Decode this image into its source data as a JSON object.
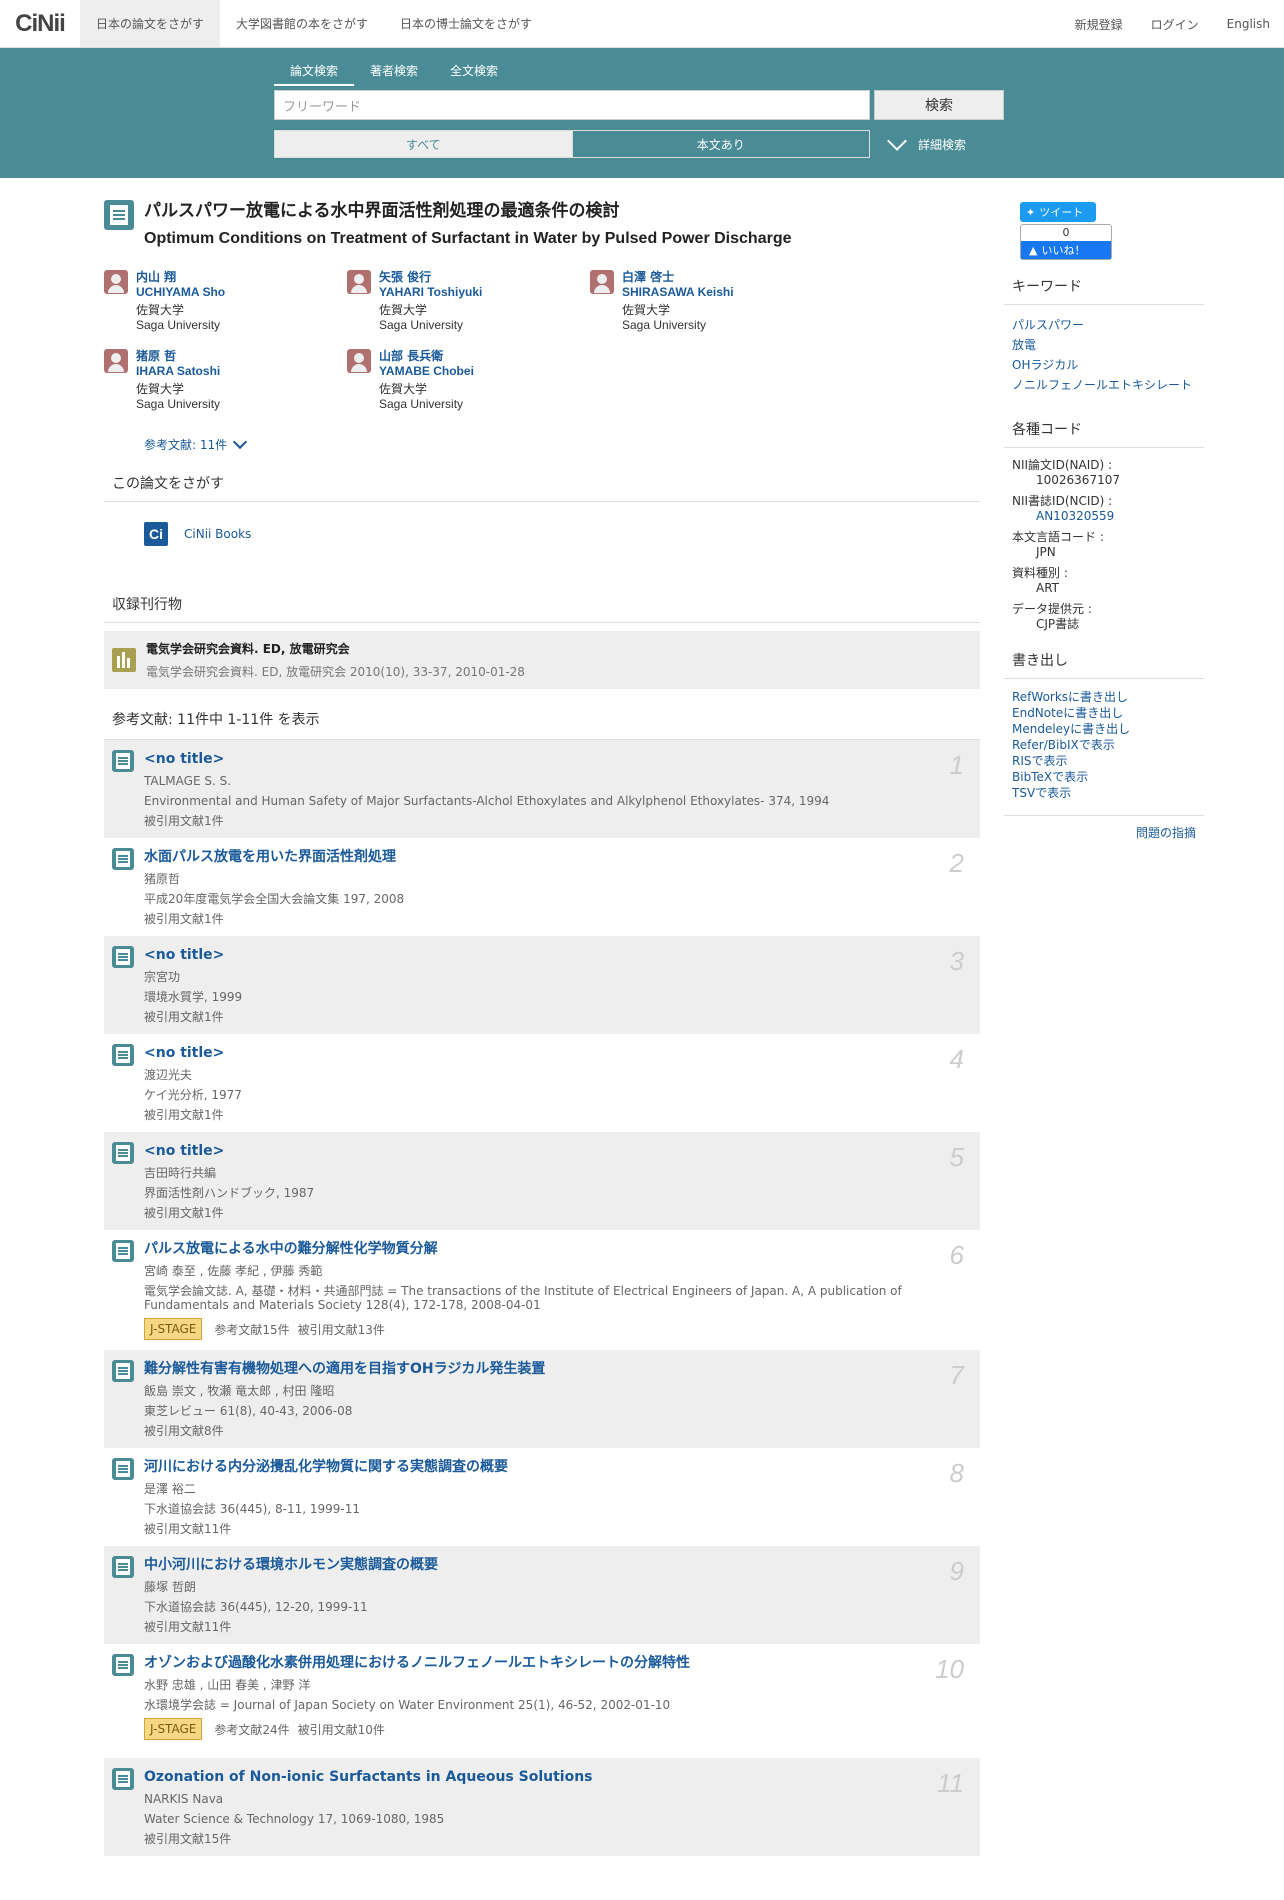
{
  "nav": {
    "logo": "CiNii",
    "tabs": [
      "日本の論文をさがす",
      "大学図書館の本をさがす",
      "日本の博士論文をさがす"
    ],
    "right": [
      "新規登録",
      "ログイン",
      "English"
    ]
  },
  "search": {
    "tabs": [
      "論文検索",
      "著者検索",
      "全文検索"
    ],
    "placeholder": "フリーワード",
    "button": "検索",
    "toggle_all": "すべて",
    "toggle_body": "本文あり",
    "advanced": "詳細検索"
  },
  "article": {
    "title_ja": "パルスパワー放電による水中界面活性剤処理の最適条件の検討",
    "title_en": "Optimum Conditions on Treatment of Surfactant in Water by Pulsed Power Discharge",
    "authors": [
      {
        "ja": "内山 翔",
        "en": "UCHIYAMA Sho",
        "aff_ja": "佐賀大学",
        "aff_en": "Saga University"
      },
      {
        "ja": "矢張 俊行",
        "en": "YAHARI Toshiyuki",
        "aff_ja": "佐賀大学",
        "aff_en": "Saga University"
      },
      {
        "ja": "白澤 啓士",
        "en": "SHIRASAWA Keishi",
        "aff_ja": "佐賀大学",
        "aff_en": "Saga University"
      },
      {
        "ja": "猪原 哲",
        "en": "IHARA Satoshi",
        "aff_ja": "佐賀大学",
        "aff_en": "Saga University"
      },
      {
        "ja": "山部 長兵衛",
        "en": "YAMABE Chobei",
        "aff_ja": "佐賀大学",
        "aff_en": "Saga University"
      }
    ],
    "refs_link": "参考文献: 11件"
  },
  "find": {
    "heading": "この論文をさがす",
    "cinii_books": "CiNii Books"
  },
  "journal": {
    "heading": "収録刊行物",
    "title": "電気学会研究会資料. ED, 放電研究会",
    "sub": "電気学会研究会資料. ED, 放電研究会 2010(10), 33-37, 2010-01-28"
  },
  "refs": {
    "heading": "参考文献:  11件中 1-11件 を表示",
    "items": [
      {
        "num": "1",
        "title": "<no title>",
        "authors": "TALMAGE S. S.",
        "source": "Environmental and Human Safety of Major Surfactants-Alchol Ethoxylates and Alkylphenol Ethoxylates- 374, 1994",
        "cited": "被引用文献1件"
      },
      {
        "num": "2",
        "title": "水面パルス放電を用いた界面活性剤処理",
        "authors": "猪原哲",
        "source": "平成20年度電気学会全国大会論文集 197, 2008",
        "cited": "被引用文献1件"
      },
      {
        "num": "3",
        "title": "<no title>",
        "authors": "宗宮功",
        "source": "環境水質学, 1999",
        "cited": "被引用文献1件"
      },
      {
        "num": "4",
        "title": "<no title>",
        "authors": "渡辺光夫",
        "source": "ケイ光分析, 1977",
        "cited": "被引用文献1件"
      },
      {
        "num": "5",
        "title": "<no title>",
        "authors": "吉田時行共編",
        "source": "界面活性剤ハンドブック, 1987",
        "cited": "被引用文献1件"
      },
      {
        "num": "6",
        "title": "パルス放電による水中の難分解性化学物質分解",
        "authors": "宮崎 泰至 , 佐藤 孝紀 , 伊藤 秀範",
        "source": "電気学会論文誌. A, 基礎・材料・共通部門誌 = The transactions of the Institute of Electrical Engineers of Japan. A, A publication of Fundamentals and Materials Society 128(4), 172-178, 2008-04-01",
        "jstage": "J-STAGE",
        "refcount": "参考文献15件",
        "cited": "被引用文献13件"
      },
      {
        "num": "7",
        "title": "難分解性有害有機物処理への適用を目指すOHラジカル発生装置",
        "authors": "飯島 崇文 , 牧瀬 竜太郎 , 村田 隆昭",
        "source": "東芝レビュー 61(8), 40-43, 2006-08",
        "cited": "被引用文献8件"
      },
      {
        "num": "8",
        "title": "河川における内分泌攪乱化学物質に関する実態調査の概要",
        "authors": "是澤 裕二",
        "source": "下水道協会誌 36(445), 8-11, 1999-11",
        "cited": "被引用文献11件"
      },
      {
        "num": "9",
        "title": "中小河川における環境ホルモン実態調査の概要",
        "authors": "藤塚 哲朗",
        "source": "下水道協会誌 36(445), 12-20, 1999-11",
        "cited": "被引用文献11件"
      },
      {
        "num": "10",
        "title": "オゾンおよび過酸化水素併用処理におけるノニルフェノールエトキシレートの分解特性",
        "authors": "水野 忠雄 , 山田 春美 , 津野 洋",
        "source": "水環境学会誌 = Journal of Japan Society on Water Environment 25(1), 46-52, 2002-01-10",
        "jstage": "J-STAGE",
        "refcount": "参考文献24件",
        "cited": "被引用文献10件"
      },
      {
        "num": "11",
        "title": "Ozonation of Non-ionic Surfactants in Aqueous Solutions",
        "authors": "NARKIS Nava",
        "source": "Water Science & Technology 17, 1069-1080, 1985",
        "cited": "被引用文献15件"
      }
    ]
  },
  "sidebar": {
    "tweet": "ツイート",
    "like_count": "0",
    "like": "いいね！",
    "keywords_heading": "キーワード",
    "keywords": [
      "パルスパワー",
      "放電",
      "OHラジカル",
      "ノニルフェノールエトキシレート"
    ],
    "codes_heading": "各種コード",
    "codes": [
      {
        "label": "NII論文ID(NAID) :",
        "value": "10026367107",
        "link": false
      },
      {
        "label": "NII書誌ID(NCID) :",
        "value": "AN10320559",
        "link": true
      },
      {
        "label": "本文言語コード :",
        "value": "JPN",
        "link": false
      },
      {
        "label": "資料種別 :",
        "value": "ART",
        "link": false
      },
      {
        "label": "データ提供元 :",
        "value": "CJP書誌",
        "link": false
      }
    ],
    "export_heading": "書き出し",
    "export": [
      "RefWorksに書き出し",
      "EndNoteに書き出し",
      "Mendeleyに書き出し",
      "Refer/BibIXで表示",
      "RISで表示",
      "BibTeXで表示",
      "TSVで表示"
    ],
    "report": "問題の指摘"
  }
}
